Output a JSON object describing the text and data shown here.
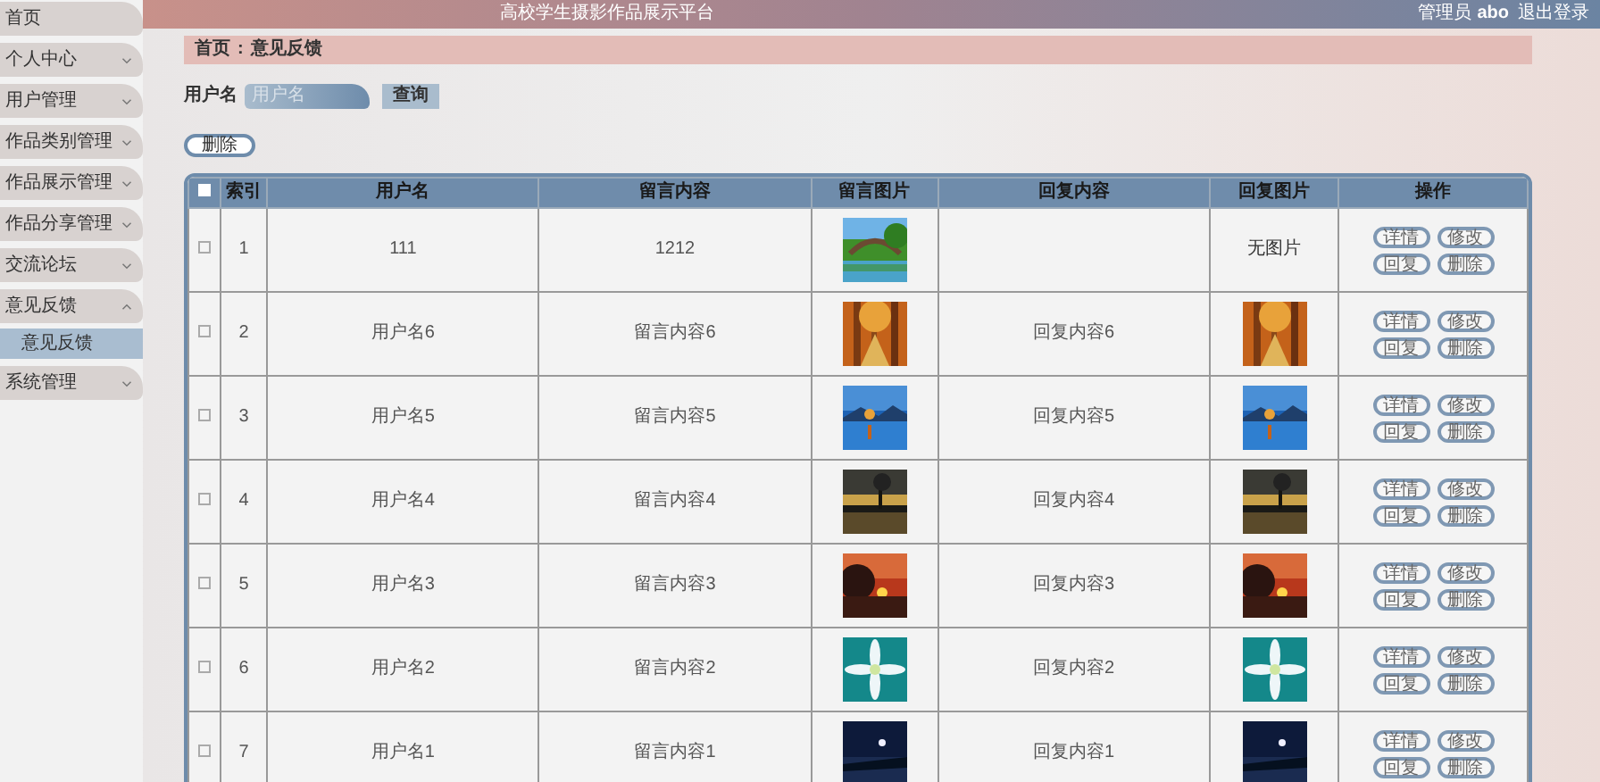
{
  "header": {
    "title": "高校学生摄影作品展示平台",
    "role": "管理员",
    "user": "abo",
    "logout": "退出登录"
  },
  "sidebar": {
    "items": [
      {
        "label": "首页",
        "kind": "link"
      },
      {
        "label": "个人中心",
        "kind": "menu",
        "expanded": false
      },
      {
        "label": "用户管理",
        "kind": "menu",
        "expanded": false
      },
      {
        "label": "作品类别管理",
        "kind": "menu",
        "expanded": false
      },
      {
        "label": "作品展示管理",
        "kind": "menu",
        "expanded": false
      },
      {
        "label": "作品分享管理",
        "kind": "menu",
        "expanded": false
      },
      {
        "label": "交流论坛",
        "kind": "menu",
        "expanded": false
      },
      {
        "label": "意见反馈",
        "kind": "menu",
        "expanded": true,
        "children": [
          {
            "label": "意见反馈",
            "selected": true
          }
        ]
      },
      {
        "label": "系统管理",
        "kind": "menu",
        "expanded": false
      }
    ]
  },
  "breadcrumb": {
    "items": [
      "首页",
      "意见反馈"
    ],
    "separator": ":"
  },
  "search": {
    "label": "用户名",
    "placeholder": "用户名",
    "button": "查询"
  },
  "delete_button": "删除",
  "table": {
    "header_checkbox": {
      "checked": false
    },
    "columns": [
      "索引",
      "用户名",
      "留言内容",
      "留言图片",
      "回复内容",
      "回复图片",
      "操作"
    ],
    "rows": [
      {
        "checked": false,
        "index": "1",
        "username": "111",
        "message": "1212",
        "reply_image": {
          "kind": "text",
          "text": "无图片"
        },
        "actions": [
          "详情",
          "修改",
          "回复",
          "删除"
        ]
      },
      {
        "checked": false,
        "index": "2",
        "username": "用户名6",
        "message": "留言内容6",
        "reply": "回复内容6",
        "actions": [
          "详情",
          "修改",
          "回复",
          "删除"
        ]
      },
      {
        "checked": false,
        "index": "3",
        "username": "用户名5",
        "message": "留言内容5",
        "reply": "回复内容5",
        "actions": [
          "详情",
          "修改",
          "回复",
          "删除"
        ]
      },
      {
        "checked": false,
        "index": "4",
        "username": "用户名4",
        "message": "留言内容4",
        "reply": "回复内容4",
        "actions": [
          "详情",
          "修改",
          "回复",
          "删除"
        ]
      },
      {
        "checked": false,
        "index": "5",
        "username": "用户名3",
        "message": "留言内容3",
        "reply": "回复内容3",
        "actions": [
          "详情",
          "修改",
          "回复",
          "删除"
        ]
      },
      {
        "checked": false,
        "index": "6",
        "username": "用户名2",
        "message": "留言内容2",
        "reply": "回复内容2",
        "actions": [
          "详情",
          "修改",
          "回复",
          "删除"
        ]
      },
      {
        "checked": false,
        "index": "7",
        "username": "用户名1",
        "message": "留言内容1",
        "reply": "回复内容1",
        "actions": [
          "详情",
          "修改",
          "回复",
          "删除"
        ]
      }
    ]
  }
}
